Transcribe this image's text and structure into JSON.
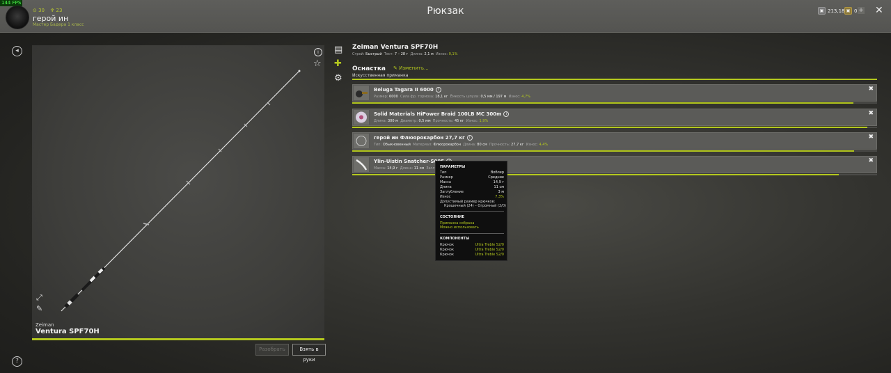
{
  "fps": "144 FPS",
  "header": {
    "title": "Рюкзак",
    "player": {
      "name": "герой ин",
      "subtitle": "Мастер Бадера 1 класс",
      "stat1": "30",
      "stat2": "23"
    },
    "silver": "213,18",
    "gold": "0",
    "plus": "+",
    "close": "✕"
  },
  "rod": {
    "brand": "Zeiman",
    "model": "Ventura SPF70H",
    "full_title": "Zeiman Ventura SPF70H",
    "specs": {
      "action_label": "Строй:",
      "action": "Быстрый",
      "test_label": "Тест:",
      "test": "7 – 28 г",
      "length_label": "Длина:",
      "length": "2,1 м",
      "wear_label": "Износ:",
      "wear": "0,1%"
    }
  },
  "buttons": {
    "disassemble": "Разобрать",
    "take": "Взять в руки"
  },
  "rig": {
    "title": "Оснастка",
    "change": "Изменить...",
    "subtitle": "Искусственная приманка"
  },
  "slots": [
    {
      "name": "Beluga Tagara II 6000",
      "specs": [
        {
          "label": "Размер:",
          "value": "6000"
        },
        {
          "label": "Сила фр. тормоза:",
          "value": "18,1 кг"
        },
        {
          "label": "Ёмкость шпули:",
          "value": "0,5 мм / 197 м"
        },
        {
          "label": "Износ:",
          "value": "4,7%",
          "wear": true
        }
      ],
      "fill": 0.955
    },
    {
      "name": "Solid Materials HiPower Braid 100LB MC 300m",
      "specs": [
        {
          "label": "Длина:",
          "value": "300 м"
        },
        {
          "label": "Диаметр:",
          "value": "0,5 мм"
        },
        {
          "label": "Прочность:",
          "value": "45 кг"
        },
        {
          "label": "Износ:",
          "value": "1,9%",
          "wear": true
        }
      ],
      "fill": 0.981
    },
    {
      "name": "герой ин Флюорокарбон 27,7 кг",
      "specs": [
        {
          "label": "Тип:",
          "value": "Обыкновенный"
        },
        {
          "label": "Материал:",
          "value": "Флюорокарбон"
        },
        {
          "label": "Длина:",
          "value": "80 см"
        },
        {
          "label": "Прочность:",
          "value": "27,7 кг"
        },
        {
          "label": "Износ:",
          "value": "4,4%",
          "wear": true
        }
      ],
      "fill": 0.956
    },
    {
      "name": "Ylin-Uistin Snatcher-S005",
      "specs": [
        {
          "label": "Масса:",
          "value": "14,9 г"
        },
        {
          "label": "Длина:",
          "value": "11 см"
        },
        {
          "label": "Заглублени",
          "value": ""
        }
      ],
      "fill": 0.927
    }
  ],
  "tooltip": {
    "params_title": "ПАРАМЕТРЫ",
    "params": [
      {
        "label": "Тип",
        "value": "Воблер"
      },
      {
        "label": "Размер",
        "value": "Средние"
      },
      {
        "label": "Масса",
        "value": "14,9 г"
      },
      {
        "label": "Длина",
        "value": "11 см"
      },
      {
        "label": "Заглубление",
        "value": "3 м"
      },
      {
        "label": "Износ",
        "value": "7,3%",
        "wear": true
      }
    ],
    "hook_size_label": "Допустимый размер крючков:",
    "hook_size_value": "Крошечный (24) – Огромный (2/0)",
    "state_title": "СОСТОЯНИЕ",
    "state_1": "Приманка собрана",
    "state_2": "Можно использовать",
    "components_title": "КОМПОНЕНТЫ",
    "components": [
      {
        "label": "Крючок",
        "value": "Ultra Treble S2/0"
      },
      {
        "label": "Крючок",
        "value": "Ultra Treble S2/0"
      },
      {
        "label": "Крючок",
        "value": "Ultra Treble S2/0"
      }
    ]
  }
}
